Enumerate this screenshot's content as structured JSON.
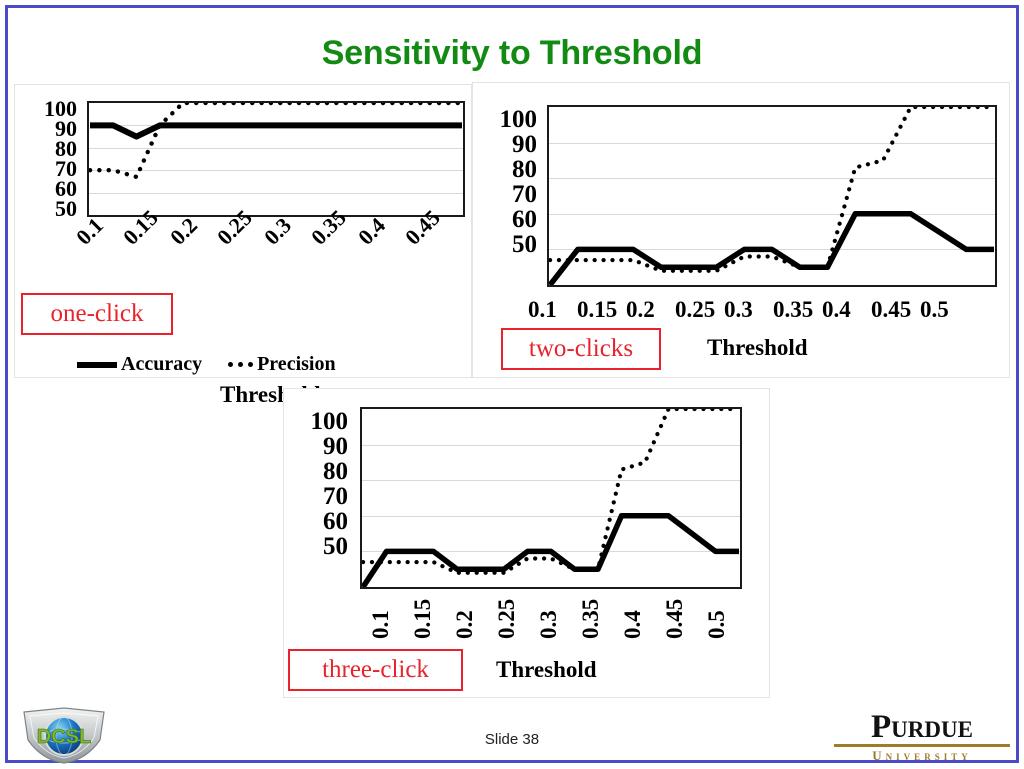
{
  "slide": {
    "title": "Sensitivity to Threshold",
    "title_color": "#138a13",
    "border_color": "#4b4bc8",
    "footer_label": "Slide 38"
  },
  "footer": {
    "logo_left_name": "DCSL",
    "logo_right_top": "Purdue",
    "logo_right_bottom": "University"
  },
  "legend": {
    "accuracy_label": "Accuracy",
    "precision_label": "Precision"
  },
  "callouts": {
    "one": "one-click",
    "two": "two-clicks",
    "three": "three-click"
  },
  "axis": {
    "threshold_title": "Threshold"
  },
  "chart_data": [
    {
      "id": "one-click",
      "type": "line",
      "title": "one-click",
      "xlabel": "Threshold",
      "ylabel": "",
      "ylim": [
        50,
        100
      ],
      "yticks": [
        100,
        90,
        80,
        70,
        60,
        50
      ],
      "grid": true,
      "legend_position": "bottom",
      "categories": [
        "0.1",
        "0.15",
        "0.2",
        "0.25",
        "0.3",
        "0.35",
        "0.4",
        "0.45"
      ],
      "x": [
        0.1,
        0.125,
        0.15,
        0.175,
        0.2,
        0.25,
        0.3,
        0.35,
        0.4,
        0.45,
        0.5
      ],
      "series": [
        {
          "name": "Accuracy",
          "style": "solid",
          "values": [
            90,
            90,
            85,
            90,
            90,
            90,
            90,
            90,
            90,
            90,
            90
          ]
        },
        {
          "name": "Precision",
          "style": "dotted",
          "values": [
            70,
            70,
            67,
            90,
            100,
            100,
            100,
            100,
            100,
            100,
            100
          ]
        }
      ]
    },
    {
      "id": "two-clicks",
      "type": "line",
      "title": "two-clicks",
      "xlabel": "Threshold",
      "ylabel": "",
      "ylim": [
        50,
        100
      ],
      "yticks": [
        100,
        90,
        80,
        70,
        60,
        50
      ],
      "grid": true,
      "legend_position": "none",
      "categories": [
        "0.1",
        "0.15",
        "0.2",
        "0.25",
        "0.3",
        "0.35",
        "0.4",
        "0.45",
        "0.5"
      ],
      "x": [
        0.1,
        0.125,
        0.15,
        0.175,
        0.2,
        0.225,
        0.25,
        0.275,
        0.3,
        0.325,
        0.35,
        0.375,
        0.4,
        0.425,
        0.45,
        0.475,
        0.5
      ],
      "series": [
        {
          "name": "Accuracy",
          "style": "solid",
          "values": [
            50,
            60,
            60,
            60,
            55,
            55,
            55,
            60,
            60,
            55,
            55,
            70,
            70,
            70,
            65,
            60,
            60
          ]
        },
        {
          "name": "Precision",
          "style": "dotted",
          "values": [
            57,
            57,
            57,
            57,
            54,
            54,
            54,
            58,
            58,
            55,
            55,
            83,
            85,
            100,
            100,
            100,
            100
          ]
        }
      ]
    },
    {
      "id": "three-click",
      "type": "line",
      "title": "three-click",
      "xlabel": "Threshold",
      "ylabel": "",
      "ylim": [
        50,
        100
      ],
      "yticks": [
        100,
        90,
        80,
        70,
        60,
        50
      ],
      "grid": true,
      "legend_position": "none",
      "categories": [
        "0.1",
        "0.15",
        "0.2",
        "0.25",
        "0.3",
        "0.35",
        "0.4",
        "0.45",
        "0.5"
      ],
      "x": [
        0.1,
        0.125,
        0.15,
        0.175,
        0.2,
        0.225,
        0.25,
        0.275,
        0.3,
        0.325,
        0.35,
        0.375,
        0.4,
        0.425,
        0.45,
        0.475,
        0.5
      ],
      "series": [
        {
          "name": "Accuracy",
          "style": "solid",
          "values": [
            50,
            60,
            60,
            60,
            55,
            55,
            55,
            60,
            60,
            55,
            55,
            70,
            70,
            70,
            65,
            60,
            60
          ]
        },
        {
          "name": "Precision",
          "style": "dotted",
          "values": [
            57,
            57,
            57,
            57,
            54,
            54,
            54,
            58,
            58,
            55,
            55,
            83,
            85,
            100,
            100,
            100,
            100
          ]
        }
      ]
    }
  ]
}
